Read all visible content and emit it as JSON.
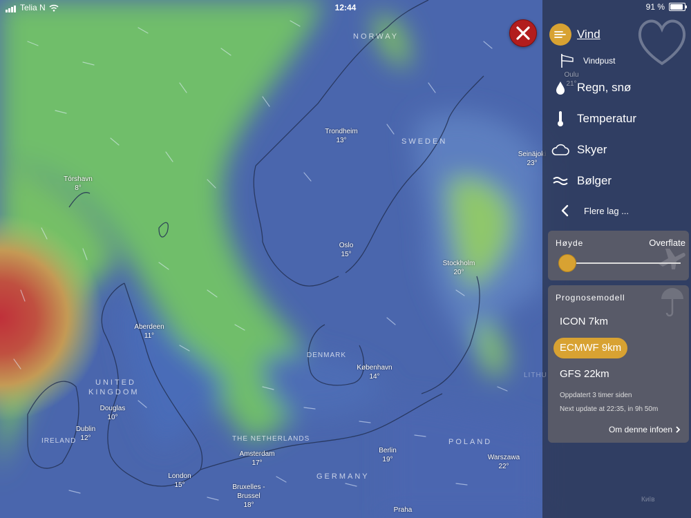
{
  "status_bar": {
    "carrier": "Telia N",
    "time": "12:44",
    "battery": "91 %"
  },
  "cities": [
    {
      "name": "Trondheim",
      "temp": "13°"
    },
    {
      "name": "Tórshavn",
      "temp": "8°"
    },
    {
      "name": "Oslo",
      "temp": "15°"
    },
    {
      "name": "Stockholm",
      "temp": "20°"
    },
    {
      "name": "Aberdeen",
      "temp": "11°"
    },
    {
      "name": "København",
      "temp": "14°"
    },
    {
      "name": "Douglas",
      "temp": "10°"
    },
    {
      "name": "Dublin",
      "temp": "12°"
    },
    {
      "name": "London",
      "temp": "15°"
    },
    {
      "name": "Amsterdam",
      "temp": "17°"
    },
    {
      "name": "Berlin",
      "temp": "19°"
    },
    {
      "name": "Warszawa",
      "temp": "22°"
    },
    {
      "name": "Bruxelles - Brussel",
      "temp": "18°"
    },
    {
      "name": "Praha",
      "temp": ""
    },
    {
      "name": "Seinäjoki",
      "temp": "23°"
    },
    {
      "name": "Oulu",
      "temp": "21°"
    }
  ],
  "countries": {
    "norway": "NORWAY",
    "sweden": "SWEDEN",
    "denmark": "DENMARK",
    "uk1": "UNITED",
    "uk2": "KINGDOM",
    "ireland": "IRELAND",
    "netherlands": "THE NETHERLANDS",
    "germany": "GERMANY",
    "poland": "POLAND",
    "lithuania": "LITHU",
    "kyiv": "Київ"
  },
  "layers": {
    "wind": "Vind",
    "gusts": "Vindpust",
    "rain": "Regn, snø",
    "temp": "Temperatur",
    "clouds": "Skyer",
    "waves": "Bølger",
    "more": "Flere lag ..."
  },
  "altitude": {
    "label": "Høyde",
    "value": "Overflate",
    "level": 0
  },
  "model": {
    "title": "Prognosemodell",
    "options": [
      "ICON 7km",
      "ECMWF 9km",
      "GFS 22km"
    ],
    "selected": "ECMWF 9km",
    "updated": "Oppdatert 3 timer siden",
    "next": "Next update at 22:35, in 9h 50m",
    "info_link": "Om denne infoen"
  },
  "colors": {
    "accent": "#d8a232",
    "close": "#b21d1d"
  }
}
